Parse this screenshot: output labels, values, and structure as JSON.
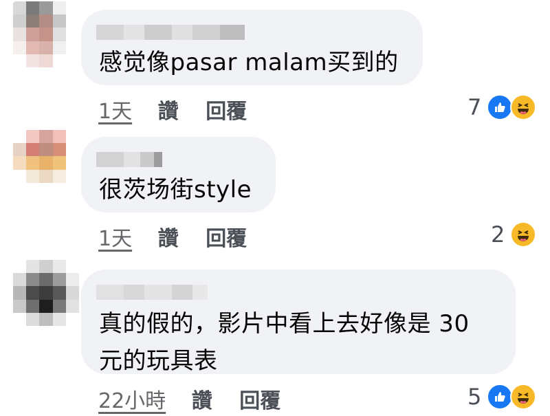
{
  "comments": [
    {
      "text_lines": [
        "感觉像pasar malam买到的"
      ],
      "time": "1天",
      "like_label": "讚",
      "reply_label": "回覆",
      "reaction_count": "7",
      "reactions": [
        "like-icon",
        "haha-icon"
      ]
    },
    {
      "text_lines": [
        "很茨场街style"
      ],
      "time": "1天",
      "like_label": "讚",
      "reply_label": "回覆",
      "reaction_count": "2",
      "reactions": [
        "haha-icon"
      ]
    },
    {
      "text_lines": [
        "真的假的，影片中看上去好像是 30",
        "元的玩具表"
      ],
      "time": "22小時",
      "like_label": "讚",
      "reply_label": "回覆",
      "reaction_count": "5",
      "reactions": [
        "like-icon",
        "haha-icon"
      ]
    }
  ],
  "colors": {
    "bubble": "#f0f2f5",
    "like": "#1877f2",
    "haha": "#f7b928"
  }
}
